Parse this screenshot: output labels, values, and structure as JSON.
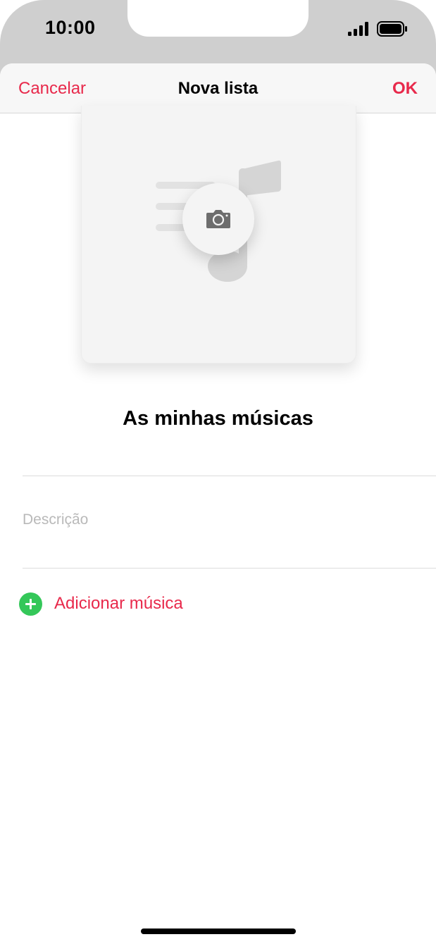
{
  "status_bar": {
    "time": "10:00",
    "icons": [
      "signal-icon",
      "battery-icon"
    ]
  },
  "navbar": {
    "cancel_label": "Cancelar",
    "title": "Nova lista",
    "ok_label": "OK"
  },
  "artwork": {
    "icons": [
      "music-note-icon",
      "camera-icon"
    ]
  },
  "playlist": {
    "name": "As minhas músicas",
    "description_placeholder": "Descrição",
    "description_value": ""
  },
  "actions": {
    "add_music_label": "Adicionar música"
  },
  "colors": {
    "accent": "#e8294b",
    "add_icon": "#34c759",
    "placeholder": "#b9b9b9"
  }
}
